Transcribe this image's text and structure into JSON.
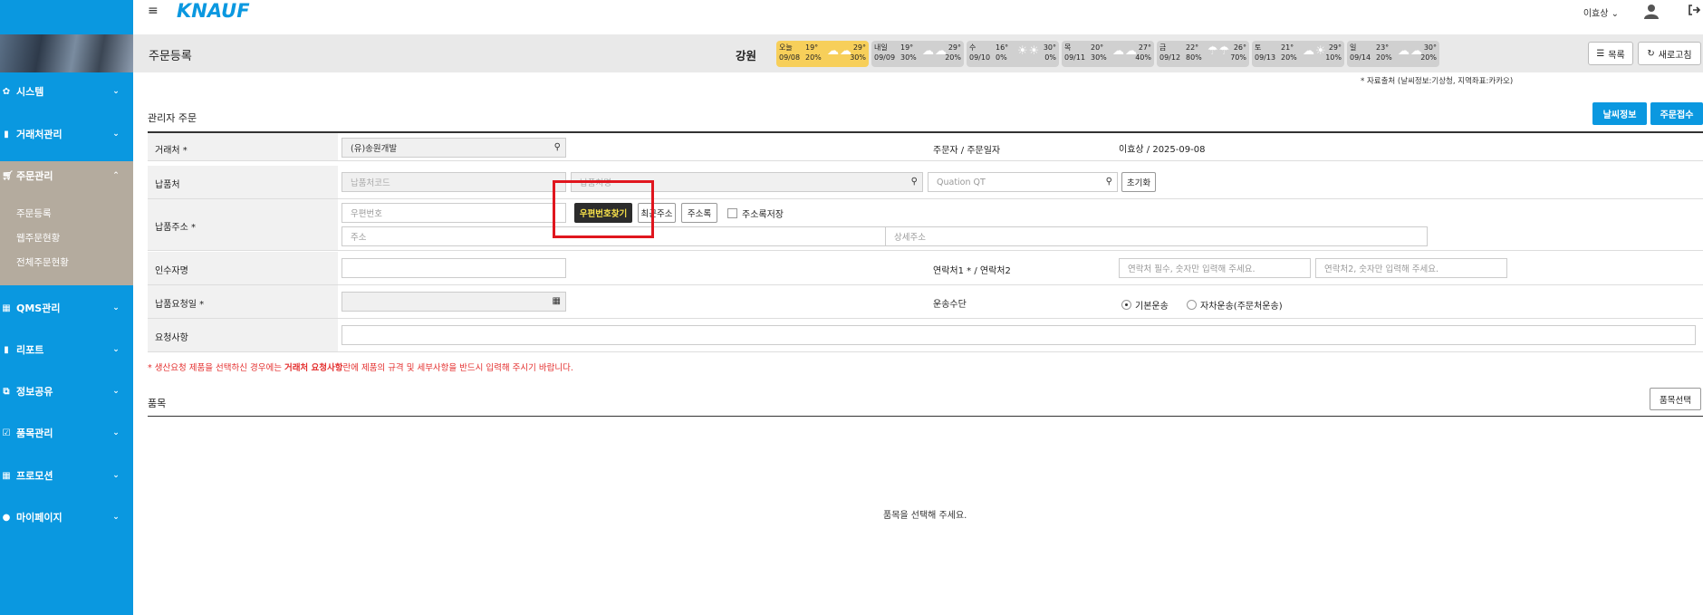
{
  "topbar": {
    "logo": "KNAUF",
    "user_name": "이효상 ⌄"
  },
  "sidebar": {
    "items": [
      {
        "label": "시스템",
        "icon": "gear-icon"
      },
      {
        "label": "거래처관리",
        "icon": "bookmark-icon"
      },
      {
        "label": "주문관리",
        "icon": "cart-icon"
      },
      {
        "label": "QMS관리",
        "icon": "grid-icon"
      },
      {
        "label": "리포트",
        "icon": "report-icon"
      },
      {
        "label": "정보공유",
        "icon": "share-icon"
      },
      {
        "label": "품목관리",
        "icon": "checklist-icon"
      },
      {
        "label": "프로모션",
        "icon": "apps-icon"
      },
      {
        "label": "마이페이지",
        "icon": "user-icon"
      }
    ],
    "subitems": [
      "주문등록",
      "웹주문현황",
      "전체주문현황"
    ]
  },
  "header": {
    "title": "주문등록",
    "region": "강원",
    "list_btn": "목록",
    "refresh_btn": "새로고침",
    "source_note": "* 자료출처 (날씨정보:기상청, 지역좌표:카카오)"
  },
  "weather": [
    {
      "day": "오늘",
      "date": "09/08",
      "temp": "19°",
      "rain": "20%",
      "temp2": "29°",
      "rain2": "30%",
      "icons": "☁☁"
    },
    {
      "day": "내일",
      "date": "09/09",
      "temp": "19°",
      "rain": "30%",
      "temp2": "29°",
      "rain2": "20%",
      "icons": "☁☁"
    },
    {
      "day": "수",
      "date": "09/10",
      "temp": "16°",
      "rain": "0%",
      "temp2": "30°",
      "rain2": "0%",
      "icons": "☀☀"
    },
    {
      "day": "목",
      "date": "09/11",
      "temp": "20°",
      "rain": "30%",
      "temp2": "27°",
      "rain2": "40%",
      "icons": "☁☁"
    },
    {
      "day": "금",
      "date": "09/12",
      "temp": "22°",
      "rain": "80%",
      "temp2": "26°",
      "rain2": "70%",
      "icons": "☂☂"
    },
    {
      "day": "토",
      "date": "09/13",
      "temp": "21°",
      "rain": "20%",
      "temp2": "29°",
      "rain2": "10%",
      "icons": "☁☀"
    },
    {
      "day": "일",
      "date": "09/14",
      "temp": "23°",
      "rain": "20%",
      "temp2": "30°",
      "rain2": "20%",
      "icons": "☁☁"
    }
  ],
  "section": {
    "title": "관리자 주문",
    "weather_btn": "날씨정보",
    "submit_btn": "주문접수"
  },
  "form": {
    "client_label": "거래처 *",
    "client_value": "(유)송원개발",
    "orderer_label": "주문자 / 주문일자",
    "orderer_value": "이효상 / 2025-09-08",
    "delivery_label": "납품처",
    "delivery_code_ph": "납품처코드",
    "delivery_name_ph": "납품처명",
    "quotation_ph": "Quation QT",
    "reset_btn": "초기화",
    "address_label": "납품주소 *",
    "zip_ph": "우편번호",
    "zip_btn": "우편번호찾기",
    "recent_btn": "최근주소",
    "addrbook_btn": "주소록",
    "save_addr_label": "주소록저장",
    "address_ph": "주소",
    "detail_addr_ph": "상세주소",
    "recipient_label": "인수자명",
    "contact_label": "연락처1 * / 연락처2",
    "contact1_ph": "연락처 필수, 숫자만 입력해 주세요.",
    "contact2_ph": "연락처2, 숫자만 입력해 주세요.",
    "date_label": "납품요청일 *",
    "transport_label": "운송수단",
    "transport_opt1": "기본운송",
    "transport_opt2": "자차운송(주문처운송)",
    "request_label": "요청사항"
  },
  "note": {
    "prefix": "* 생산요청 제품을 선택하신 경우에는 ",
    "bold": "거래처 요청사항",
    "suffix": "란에 제품의 규격 및 세부사항을 반드시 입력해 주시기 바랍니다."
  },
  "items": {
    "title": "품목",
    "select_btn": "품목선택",
    "empty": "품목을 선택해 주세요."
  }
}
